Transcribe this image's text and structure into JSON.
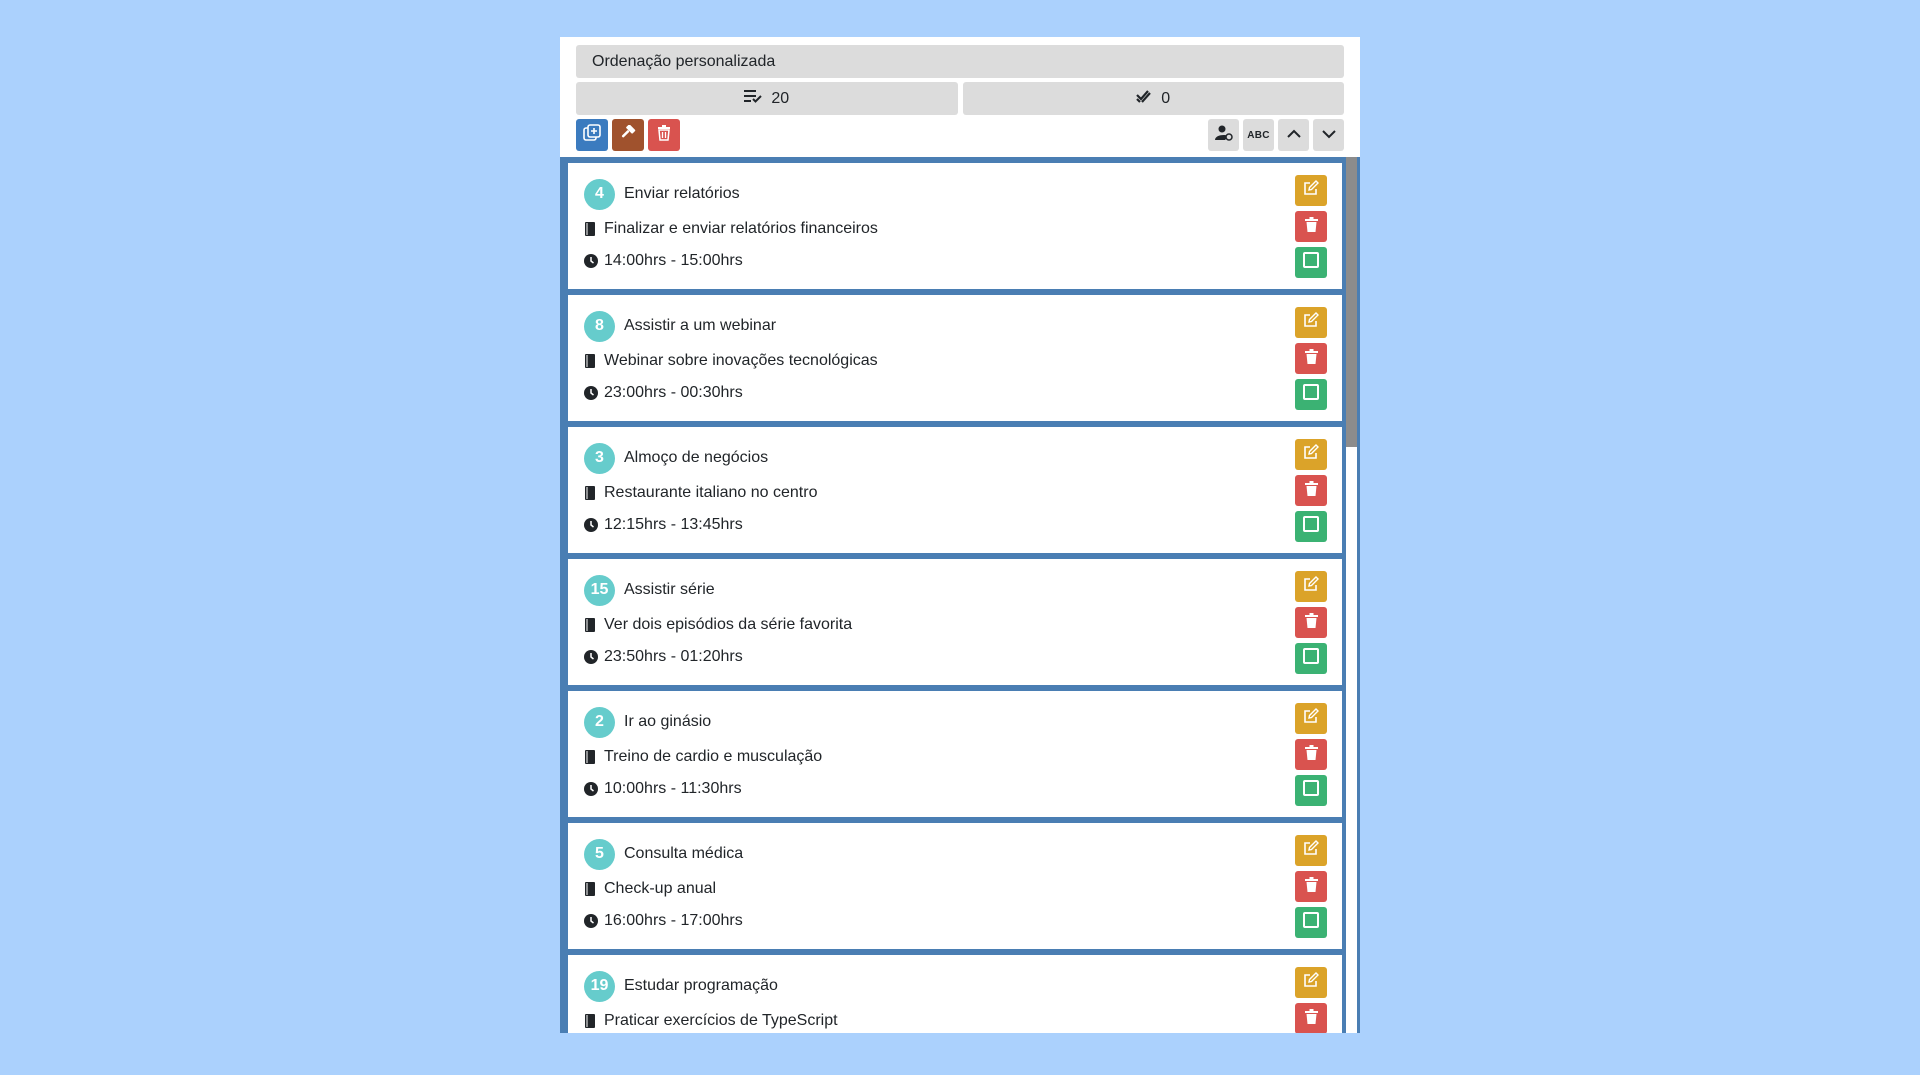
{
  "header": {
    "sort_label": "Ordenação personalizada",
    "total_count": "20",
    "done_count": "0"
  },
  "colors": {
    "background": "#abd1fd",
    "list_background": "#4a7eb3",
    "badge": "#66cccc",
    "edit": "#dba329",
    "delete": "#d9534f",
    "done": "#3bb273",
    "add": "#3b7bbf",
    "tools": "#a0522d"
  },
  "tasks": [
    {
      "num": "4",
      "title": "Enviar relatórios",
      "desc": "Finalizar e enviar relatórios financeiros",
      "time": "14:00hrs - 15:00hrs"
    },
    {
      "num": "8",
      "title": "Assistir a um webinar",
      "desc": "Webinar sobre inovações tecnológicas",
      "time": "23:00hrs - 00:30hrs"
    },
    {
      "num": "3",
      "title": "Almoço de negócios",
      "desc": "Restaurante italiano no centro",
      "time": "12:15hrs - 13:45hrs"
    },
    {
      "num": "15",
      "title": "Assistir série",
      "desc": "Ver dois episódios da série favorita",
      "time": "23:50hrs - 01:20hrs"
    },
    {
      "num": "2",
      "title": "Ir ao ginásio",
      "desc": "Treino de cardio e musculação",
      "time": "10:00hrs - 11:30hrs"
    },
    {
      "num": "5",
      "title": "Consulta médica",
      "desc": "Check-up anual",
      "time": "16:00hrs - 17:00hrs"
    },
    {
      "num": "19",
      "title": "Estudar programação",
      "desc": "Praticar exercícios de TypeScript",
      "time": ""
    }
  ],
  "toolbar": {
    "abc_label": "ABC"
  }
}
